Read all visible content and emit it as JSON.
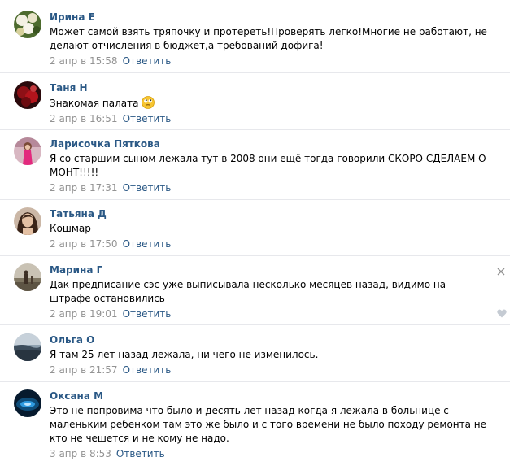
{
  "reply_label": "Ответить",
  "colors": {
    "link": "#2a5885",
    "meta": "#939393",
    "separator": "#e7e8ec"
  },
  "comments": [
    {
      "author": "Ирина Е",
      "text": "Может самой взять тряпочку и протереть!Проверять легко!Многие не работают, не делают отчисления в бюджет,а требований дофига!",
      "date": "2 апр в 15:58",
      "avatar": "flowers-avatar"
    },
    {
      "author": "Таня Н",
      "text": "Знакомая палата",
      "emoji": "rolling-eyes-emoji",
      "date": "2 апр в 16:51",
      "avatar": "roses-avatar"
    },
    {
      "author": "Ларисочка Пяткова",
      "text": "Я со старшим сыном лежала тут в 2008 они ещё тогда говорили СКОРО СДЕЛАЕМ О МОНТ!!!!!",
      "date": "2 апр в 17:31",
      "avatar": "woman-pink-avatar"
    },
    {
      "author": "Татьяна Д",
      "text": "Кошмар",
      "date": "2 апр в 17:50",
      "avatar": "woman-portrait-avatar"
    },
    {
      "author": "Марина Г",
      "text": "Дак предписание сэс уже выписывала несколько месяцев назад, видимо на штрафе остановились",
      "date": "2 апр в 19:01",
      "avatar": "landscape-avatar"
    },
    {
      "author": "Ольга О",
      "text": "Я там 25 лет назад лежала, ни чего не изменилось.",
      "date": "2 апр в 21:57",
      "avatar": "sea-avatar"
    },
    {
      "author": "Оксана М",
      "text": "Это не попровима что было и десять лет назад когда я лежала в больнице с маленьким ребенком там это же было и с того времени не было походу ремонта не кто не чешется и не кому не надо.",
      "date": "3 апр в 8:53",
      "avatar": "blue-glow-avatar"
    }
  ]
}
